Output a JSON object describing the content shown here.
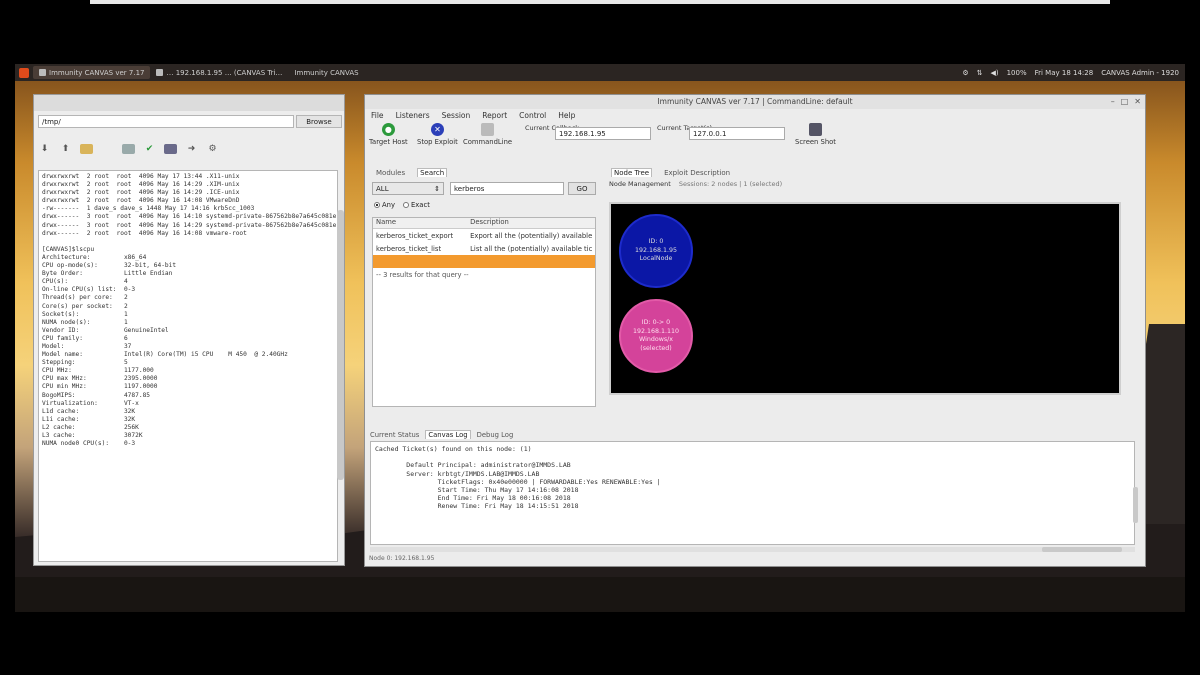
{
  "taskbar": {
    "tasks": [
      "Immunity CANVAS ver 7.17",
      "… 192.168.1.95 … (CANVAS Tri…",
      "Immunity CANVAS"
    ],
    "clock": "Fri May 18 14:28",
    "battery": "100%",
    "user": "CANVAS Admin - 1920"
  },
  "left_window": {
    "address": "/tmp/",
    "browse_label": "Browse",
    "terminal_lines": [
      "drwxrwxrwt  2 root  root  4096 May 17 13:44 .X11-unix",
      "drwxrwxrwt  2 root  root  4096 May 16 14:29 .XIM-unix",
      "drwxrwxrwt  2 root  root  4096 May 16 14:29 .ICE-unix",
      "drwxrwxrwt  2 root  root  4096 May 16 14:08 VMwareDnD",
      "-rw-------  1 dave_s dave_s 1448 May 17 14:16 krb5cc_1003",
      "drwx------  3 root  root  4096 May 16 14:10 systemd-private-867562b8e7a645c081e",
      "drwx------  3 root  root  4096 May 16 14:29 systemd-private-867562b8e7a645c081e",
      "drwx------  2 root  root  4096 May 16 14:08 vmware-root",
      "",
      "[CANVAS]$lscpu",
      "Architecture:         x86_64",
      "CPU op-mode(s):       32-bit, 64-bit",
      "Byte Order:           Little Endian",
      "CPU(s):               4",
      "On-line CPU(s) list:  0-3",
      "Thread(s) per core:   2",
      "Core(s) per socket:   2",
      "Socket(s):            1",
      "NUMA node(s):         1",
      "Vendor ID:            GenuineIntel",
      "CPU family:           6",
      "Model:                37",
      "Model name:           Intel(R) Core(TM) i5 CPU    M 450  @ 2.40GHz",
      "Stepping:             5",
      "CPU MHz:              1177.000",
      "CPU max MHz:          2395.0000",
      "CPU min MHz:          1197.0000",
      "BogoMIPS:             4787.85",
      "Virtualization:       VT-x",
      "L1d cache:            32K",
      "L1i cache:            32K",
      "L2 cache:             256K",
      "L3 cache:             3072K",
      "NUMA node0 CPU(s):    0-3"
    ]
  },
  "main_window": {
    "title": "Immunity CANVAS ver 7.17 | CommandLine: default",
    "menu": [
      "File",
      "Listeners",
      "Session",
      "Report",
      "Control",
      "Help"
    ],
    "toolbar": {
      "target_host": "Target Host",
      "stop_exploit": "Stop Exploit",
      "cli_interface": "CommandLine",
      "current_callback_label": "Current Callback",
      "current_callback_value": "192.168.1.95",
      "current_targets_label": "Current Target(s)",
      "current_targets_value": "127.0.0.1",
      "screenshot": "Screen Shot"
    },
    "left_tabs": [
      "Modules",
      "Search"
    ],
    "search": {
      "category": "ALL",
      "keyword": "kerberos",
      "go_label": "GO",
      "radio_any": "Any",
      "radio_exact": "Exact"
    },
    "results": {
      "columns": [
        "Name",
        "Description"
      ],
      "rows": [
        {
          "name": "kerberos_ticket_export",
          "desc": "Export all the (potentially) available"
        },
        {
          "name": "kerberos_ticket_list",
          "desc": "List all the (potentially) available tic"
        },
        {
          "name": "",
          "desc": ""
        }
      ],
      "note": "-- 3 results for that query --"
    },
    "right_tabs": [
      "Node Tree",
      "Exploit Description"
    ],
    "inner_tabs": [
      "Node Management",
      "Sessions: 2 nodes | 1 (selected)"
    ],
    "nodes": [
      {
        "line1": "ID: 0",
        "line2": "192.168.1.95",
        "line3": "LocalNode",
        "line4": ""
      },
      {
        "line1": "ID: 0-> 0",
        "line2": "192.168.1.110",
        "line4": "(selected)",
        "line3": "Windows/x"
      }
    ],
    "bottom_tabs": [
      "Current Status",
      "Canvas Log",
      "Debug Log"
    ],
    "log_lines": [
      "Cached Ticket(s) found on this node: (1)",
      "",
      "        Default Principal: administrator@IMMDS.LAB",
      "        Server: krbtgt/IMMDS.LAB@IMMDS.LAB",
      "                TicketFlags: 0x40e00000 | FORWARDABLE:Yes RENEWABLE:Yes |",
      "                Start Time: Thu May 17 14:16:08 2018",
      "                End Time: Fri May 18 00:16:08 2018",
      "                Renew Time: Fri May 18 14:15:51 2018"
    ],
    "statusbar": "Node 0: 192.168.1.95"
  },
  "colors": {
    "node_local": "#0b17a6",
    "node_selected": "#d4439a",
    "selection_row": "#f39a2e"
  }
}
